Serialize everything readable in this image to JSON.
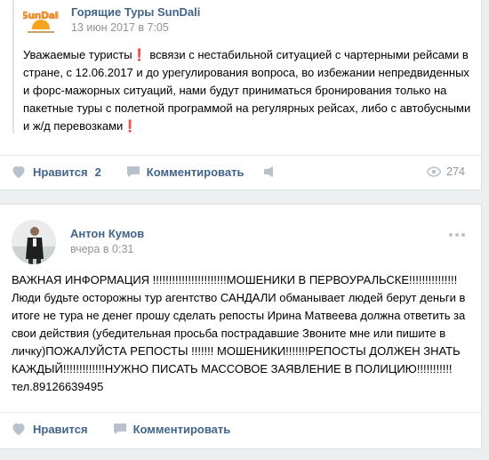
{
  "posts": [
    {
      "author": "Горящие Туры SunDali",
      "logo_text": "SunDali",
      "date": "13 июн 2017 в 7:05",
      "text": "Уважаемые туристы❗ всвязи с нестабильной ситуацией с чартерными рейсами в стране, с 12.06.2017 и до урегулирования вопроса, во избежании непредвиденных и форс-мажорных ситуаций, нами будут приниматься бронирования только на пакетные туры с полетной программой на регулярных рейсах, либо с автобусными и ж/д перевозками❗",
      "like_label": "Нравится",
      "like_count": "2",
      "comment_label": "Комментировать",
      "views": "274"
    },
    {
      "author": "Антон Кумов",
      "date": "вчера в 0:31",
      "text": "ВАЖНАЯ ИНФОРМАЦИЯ !!!!!!!!!!!!!!!!!!!!!!!МОШЕНИКИ В ПЕРВОУРАЛЬСКЕ!!!!!!!!!!!!!!!\nЛюди будьте осторожны тур агентство САНДАЛИ обманывает людей берут деньги в итоге не тура не денег прошу сделать репосты Ирина Матвеева должна ответить за свои действия (убедительная просьба пострадавшие Звоните мне или пишите в личку)ПОЖАЛУЙСТА РЕПОСТЫ !!!!!!! МОШЕНИКИ!!!!!!!РЕПОСТЫ ДОЛЖЕН ЗНАТЬ КАЖДЫЙ!!!!!!!!!!!!!НУЖНО ПИСАТЬ МАССОВОЕ ЗАЯВЛЕНИЕ В ПОЛИЦИЮ!!!!!!!!!!!\nтел.89126639495",
      "like_label": "Нравится",
      "comment_label": "Комментировать"
    }
  ],
  "colors": {
    "link": "#42648b",
    "muted": "#939393",
    "icon": "#b8c1cc",
    "background": "#edeef0"
  },
  "icons": [
    "heart-icon",
    "comment-icon",
    "share-icon",
    "eye-icon",
    "more-icon"
  ]
}
